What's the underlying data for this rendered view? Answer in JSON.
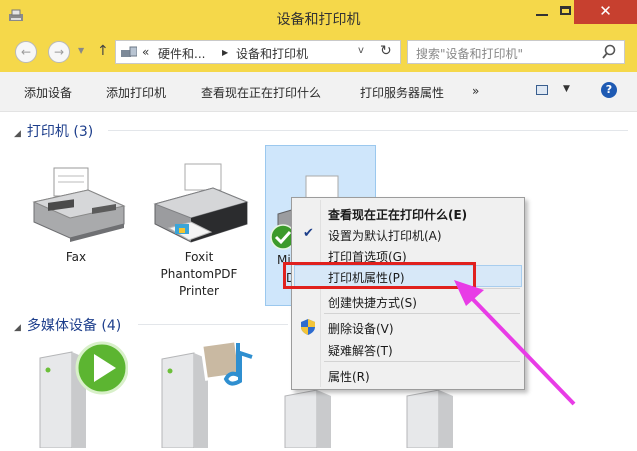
{
  "window": {
    "title": "设备和打印机",
    "close_glyph": "✕",
    "min_glyph": "",
    "max_glyph": ""
  },
  "nav": {
    "back": "←",
    "forward": "→",
    "recent": "▼",
    "up": "↑",
    "address_overflow": "«",
    "address_parts": [
      "硬件和...",
      "设备和打印机"
    ],
    "address_sep": "▶",
    "address_dropdown": "v",
    "refresh": "↻",
    "search_placeholder": "搜索\"设备和打印机\""
  },
  "toolbar": {
    "items": [
      "添加设备",
      "添加打印机",
      "查看现在正在打印什么",
      "打印服务器属性"
    ],
    "overflow": "»",
    "view_dropdown": "▼",
    "help": "?"
  },
  "groups": {
    "printers": {
      "label": "打印机 (3)",
      "toggle": "◢"
    },
    "media": {
      "label": "多媒体设备 (4)",
      "toggle": "◢"
    }
  },
  "devices": {
    "fax": "Fax",
    "foxit": [
      "Foxit",
      "PhantomPDF",
      "Printer"
    ],
    "selected_visible_1": "Mi",
    "selected_visible_2": "D"
  },
  "context_menu": {
    "items": [
      {
        "label": "查看现在正在打印什么(E)",
        "bold": true
      },
      {
        "label": "设置为默认打印机(A)",
        "checked": true
      },
      {
        "label": "打印首选项(G)"
      },
      {
        "label": "打印机属性(P)",
        "highlighted": true
      },
      {
        "label": "创建快捷方式(S)"
      },
      {
        "label": "删除设备(V)",
        "shield": true
      },
      {
        "label": "疑难解答(T)"
      },
      {
        "label": "属性(R)"
      }
    ],
    "check_glyph": "✔"
  },
  "colors": {
    "titlebar": "#f5d84a",
    "close_button": "#c7402f",
    "highlight_box": "#e0211e",
    "arrow": "#e83ce6",
    "group_header": "#1e3f8c"
  }
}
